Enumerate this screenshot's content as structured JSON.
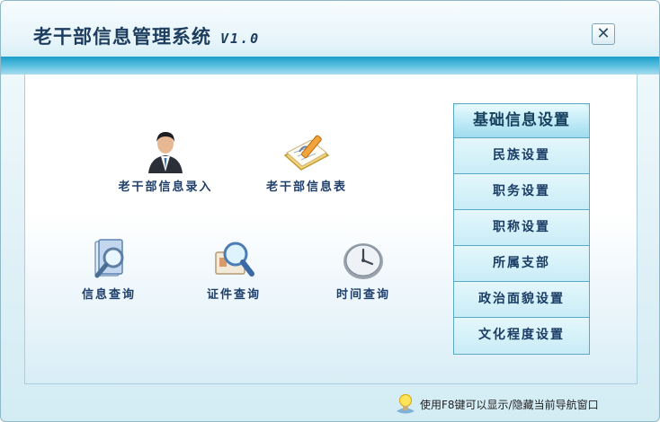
{
  "window": {
    "title": "老干部信息管理系统",
    "version": "V1.0",
    "close_label": "✕"
  },
  "shortcuts": [
    {
      "label": "老干部信息录入",
      "icon": "user-icon"
    },
    {
      "label": "老干部信息表",
      "icon": "notebook-pencil-icon"
    },
    {
      "label": "信息查询",
      "icon": "document-search-icon"
    },
    {
      "label": "证件查询",
      "icon": "card-search-icon"
    },
    {
      "label": "时间查询",
      "icon": "clock-icon"
    }
  ],
  "settings_panel": {
    "title": "基础信息设置",
    "items": [
      "民族设置",
      "职务设置",
      "职称设置",
      "所属支部",
      "政治面貌设置",
      "文化程度设置"
    ]
  },
  "status_bar": {
    "hint": "使用F8键可以显示/隐藏当前导航窗口",
    "icon": "lightbulb-icon"
  },
  "colors": {
    "title_text": "#1d3d5e",
    "accent_band": "#1a9ec9",
    "panel_bg": "#cfeef7",
    "label_text": "#1f3f6b"
  }
}
